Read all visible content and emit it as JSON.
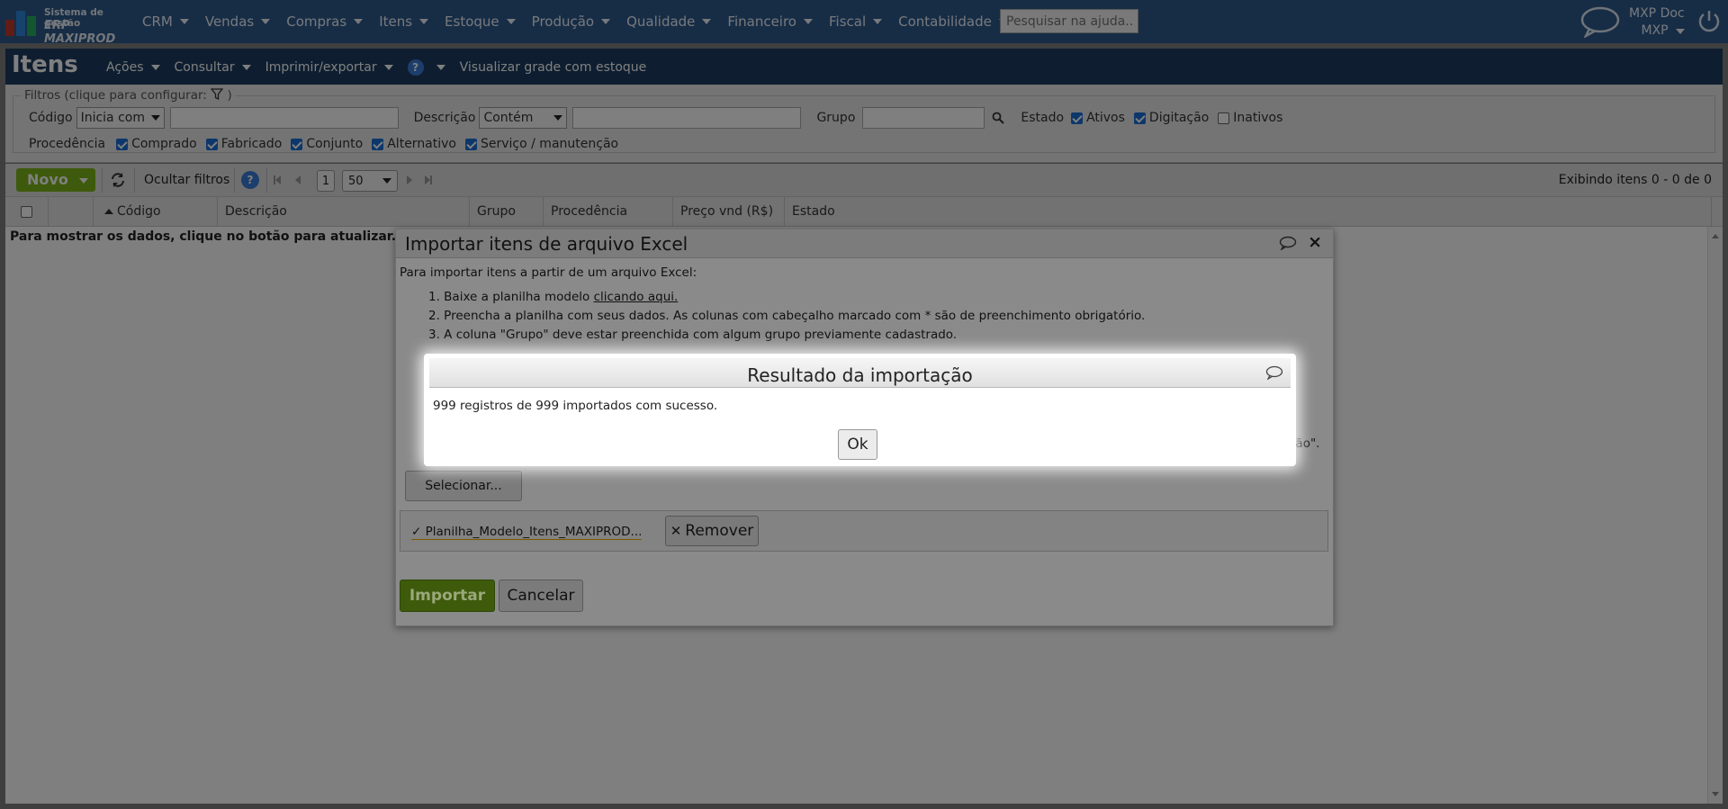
{
  "app": {
    "logo_line1": "Sistema de gestão",
    "logo_line2": "ERP MAXIPROD",
    "menu": [
      "CRM",
      "Vendas",
      "Compras",
      "Itens",
      "Estoque",
      "Produção",
      "Qualidade",
      "Financeiro",
      "Fiscal",
      "Contabilidade"
    ],
    "help_search_placeholder": "Pesquisar na ajuda...",
    "user_name": "MXP Doc",
    "user_company": "MXP"
  },
  "page": {
    "title": "Itens",
    "submenu": [
      "Ações",
      "Consultar",
      "Imprimir/exportar"
    ],
    "help_icon": "?",
    "grid_link": "Visualizar grade com estoque"
  },
  "filters": {
    "legend": "Filtros (clique para configurar:",
    "legend_end": ")",
    "codigo_label": "Código",
    "codigo_mode": "Inicia com",
    "descricao_label": "Descrição",
    "descricao_mode": "Contém",
    "grupo_label": "Grupo",
    "estado_label": "Estado",
    "estado_options": [
      {
        "label": "Ativos",
        "checked": true
      },
      {
        "label": "Digitação",
        "checked": true
      },
      {
        "label": "Inativos",
        "checked": false
      }
    ],
    "procedencia_label": "Procedência",
    "procedencia_options": [
      {
        "label": "Comprado",
        "checked": true
      },
      {
        "label": "Fabricado",
        "checked": true
      },
      {
        "label": "Conjunto",
        "checked": true
      },
      {
        "label": "Alternativo",
        "checked": true
      },
      {
        "label": "Serviço / manutenção",
        "checked": true
      }
    ]
  },
  "toolbar": {
    "novo": "Novo",
    "hide_filters": "Ocultar filtros",
    "page": "1",
    "page_size": "50",
    "status": "Exibindo itens 0 - 0 de 0"
  },
  "grid": {
    "columns": [
      "Código",
      "Descrição",
      "Grupo",
      "Procedência",
      "Preço vnd (R$)",
      "Estado"
    ],
    "empty_message": "Para mostrar os dados, clique no botão para atualizar."
  },
  "import_dialog": {
    "title": "Importar itens de arquivo Excel",
    "intro": "Para importar itens a partir de um arquivo Excel:",
    "step1_prefix": "1. Baixe a planilha modelo ",
    "step1_link": "clicando aqui.",
    "step2": "2. Preencha a planilha com seus dados. As colunas com cabeçalho marcado com * são de preenchimento obrigatório.",
    "step3": "3. A coluna \"Grupo\" deve estar preenchida com algum grupo previamente cadastrado.",
    "obscured_tail": "ção\".",
    "select_button": "Selecionar...",
    "file_name": "Planilha_Modelo_Itens_MAXIPROD...",
    "remove_button": "Remover",
    "import_button": "Importar",
    "cancel_button": "Cancelar"
  },
  "result_dialog": {
    "title": "Resultado da importação",
    "message": "999 registros de 999 importados com sucesso.",
    "ok_button": "Ok"
  },
  "colors": {
    "topbar": "#2e5a8c",
    "titlebar": "#1d3d61",
    "novo_button": "#7cb518",
    "checkbox_checked": "#1a6fd6"
  }
}
